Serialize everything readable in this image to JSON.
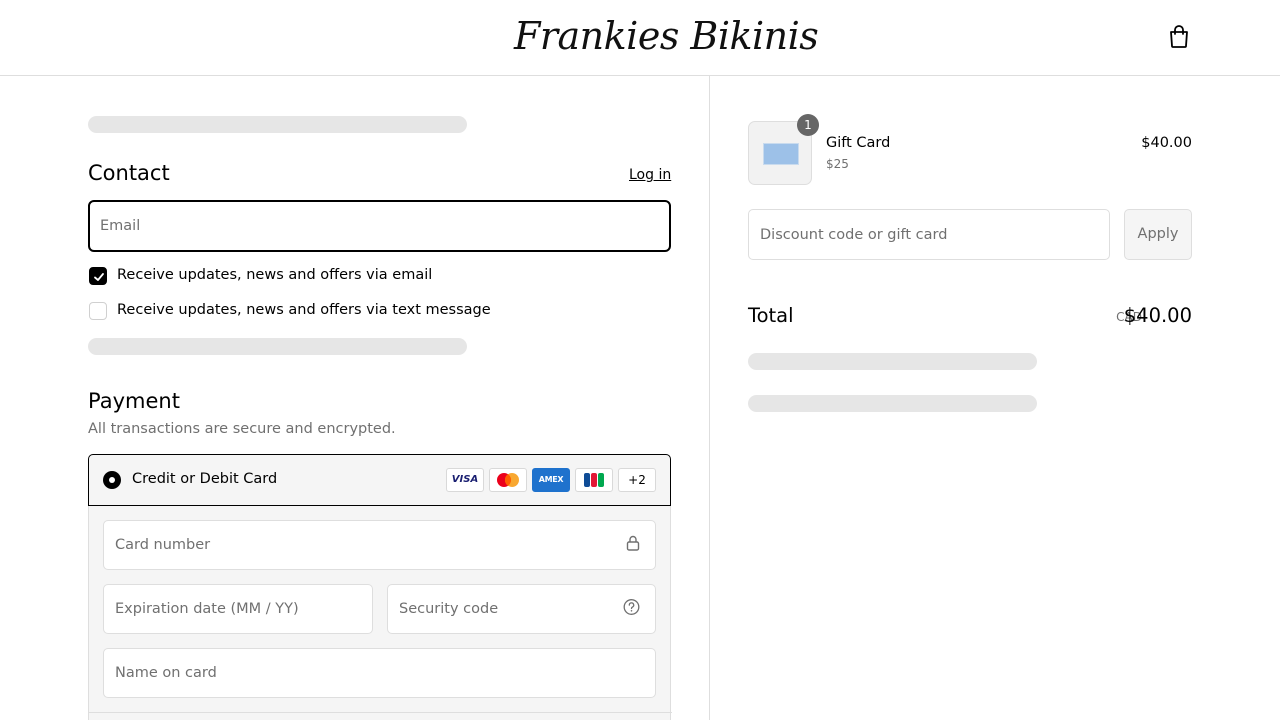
{
  "header": {
    "brand": "Frankies Bikinis",
    "cart_icon": "shopping-bag-icon"
  },
  "contact": {
    "title": "Contact",
    "login_label": "Log in",
    "email_placeholder": "Email",
    "opt_email": {
      "label": "Receive updates, news and offers via email",
      "checked": true
    },
    "opt_sms": {
      "label": "Receive updates, news and offers via text message",
      "checked": false
    }
  },
  "payment": {
    "title": "Payment",
    "subtitle": "All transactions are secure and encrypted.",
    "method_label": "Credit or Debit Card",
    "card_brands": [
      "VISA",
      "mastercard",
      "AMEX",
      "JCB"
    ],
    "more_brands": "+2",
    "card_number_placeholder": "Card number",
    "expiry_placeholder": "Expiration date (MM / YY)",
    "security_placeholder": "Security code",
    "name_placeholder": "Name on card"
  },
  "summary": {
    "item": {
      "name": "Gift Card",
      "variant": "$25",
      "price": "$40.00",
      "quantity": "1"
    },
    "discount_placeholder": "Discount code or gift card",
    "apply_label": "Apply",
    "total_label": "Total",
    "currency": "CAD",
    "total_value": "$40.00"
  }
}
